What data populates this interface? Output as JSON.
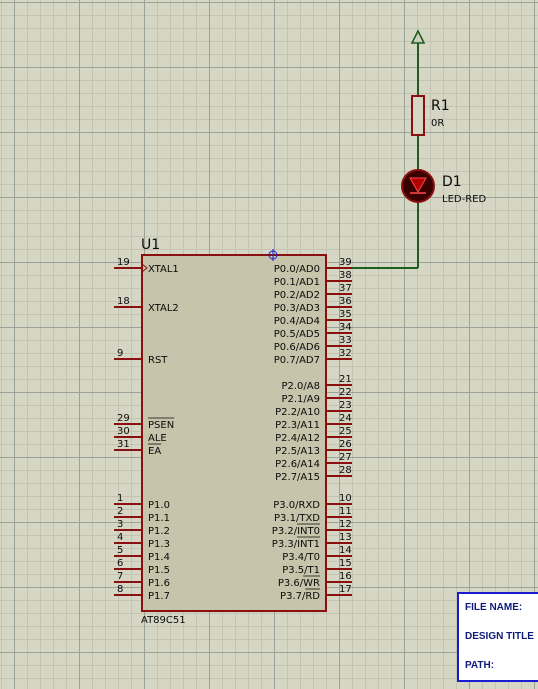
{
  "components": {
    "u1": {
      "ref": "U1",
      "part": "AT89C51",
      "left_pins": [
        {
          "num": "19",
          "name": "XTAL1",
          "clock": true
        },
        {
          "num": "18",
          "name": "XTAL2"
        },
        {
          "num": "9",
          "name": "RST"
        },
        {
          "num": "29",
          "name": "PSEN",
          "overbar": true
        },
        {
          "num": "30",
          "name": "ALE"
        },
        {
          "num": "31",
          "name": "EA",
          "overbar": true
        },
        {
          "num": "1",
          "name": "P1.0"
        },
        {
          "num": "2",
          "name": "P1.1"
        },
        {
          "num": "3",
          "name": "P1.2"
        },
        {
          "num": "4",
          "name": "P1.3"
        },
        {
          "num": "5",
          "name": "P1.4"
        },
        {
          "num": "6",
          "name": "P1.5"
        },
        {
          "num": "7",
          "name": "P1.6"
        },
        {
          "num": "8",
          "name": "P1.7"
        }
      ],
      "right_pins": [
        {
          "num": "39",
          "name": "P0.0/AD0"
        },
        {
          "num": "38",
          "name": "P0.1/AD1"
        },
        {
          "num": "37",
          "name": "P0.2/AD2"
        },
        {
          "num": "36",
          "name": "P0.3/AD3"
        },
        {
          "num": "35",
          "name": "P0.4/AD4"
        },
        {
          "num": "34",
          "name": "P0.5/AD5"
        },
        {
          "num": "33",
          "name": "P0.6/AD6"
        },
        {
          "num": "32",
          "name": "P0.7/AD7"
        },
        {
          "num": "21",
          "name": "P2.0/A8"
        },
        {
          "num": "22",
          "name": "P2.1/A9"
        },
        {
          "num": "23",
          "name": "P2.2/A10"
        },
        {
          "num": "24",
          "name": "P2.3/A11"
        },
        {
          "num": "25",
          "name": "P2.4/A12"
        },
        {
          "num": "26",
          "name": "P2.5/A13"
        },
        {
          "num": "27",
          "name": "P2.6/A14"
        },
        {
          "num": "28",
          "name": "P2.7/A15"
        },
        {
          "num": "10",
          "name": "P3.0/RXD"
        },
        {
          "num": "11",
          "name": "P3.1/TXD"
        },
        {
          "num": "12",
          "name": "P3.2/INT0",
          "overbar_part": "INT0"
        },
        {
          "num": "13",
          "name": "P3.3/INT1",
          "overbar_part": "INT1"
        },
        {
          "num": "14",
          "name": "P3.4/T0"
        },
        {
          "num": "15",
          "name": "P3.5/T1"
        },
        {
          "num": "16",
          "name": "P3.6/WR",
          "overbar_part": "WR"
        },
        {
          "num": "17",
          "name": "P3.7/RD",
          "overbar_part": "RD"
        }
      ]
    },
    "r1": {
      "ref": "R1",
      "value": "0R"
    },
    "d1": {
      "ref": "D1",
      "value": "LED-RED"
    }
  },
  "title_block": {
    "file_name_label": "FILE NAME:",
    "design_title_label": "DESIGN TITLE",
    "path_label": "PATH:"
  },
  "colors": {
    "wire": "#1f5c1f",
    "component_outline": "#8b0f0f",
    "ic_fill": "#c6c4aa",
    "led_fill": "#3a0000",
    "pin_number": "#0b0b0b",
    "title_block_border": "#1b1bd0"
  }
}
